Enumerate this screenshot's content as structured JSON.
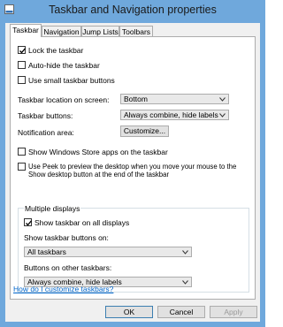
{
  "window": {
    "title": "Taskbar and Navigation properties"
  },
  "tabs": [
    {
      "label": "Taskbar",
      "active": true
    },
    {
      "label": "Navigation"
    },
    {
      "label": "Jump Lists"
    },
    {
      "label": "Toolbars"
    }
  ],
  "taskbar": {
    "lock": {
      "label": "Lock the taskbar",
      "checked": true
    },
    "autohide": {
      "label": "Auto-hide the taskbar",
      "checked": false
    },
    "small_buttons": {
      "label": "Use small taskbar buttons",
      "checked": false
    },
    "location": {
      "label": "Taskbar location on screen:",
      "value": "Bottom"
    },
    "buttons": {
      "label": "Taskbar buttons:",
      "value": "Always combine, hide labels"
    },
    "notification": {
      "label": "Notification area:",
      "button": "Customize..."
    },
    "store_apps": {
      "label": "Show Windows Store apps on the taskbar",
      "checked": false
    },
    "peek": {
      "label_line1": "Use Peek to preview the desktop when you move your mouse to the",
      "label_line2": "Show desktop button at the end of the taskbar",
      "checked": false
    },
    "multiple_displays": {
      "legend": "Multiple displays",
      "show_all": {
        "label": "Show taskbar on all displays",
        "checked": true
      },
      "show_buttons_on": {
        "label": "Show taskbar buttons on:",
        "value": "All taskbars"
      },
      "other_buttons": {
        "label": "Buttons on other taskbars:",
        "value": "Always combine, hide labels"
      }
    },
    "help_link": "How do I customize taskbars?"
  },
  "footer": {
    "ok": "OK",
    "cancel": "Cancel",
    "apply": "Apply"
  },
  "colors": {
    "frame": "#6fa8dc",
    "link": "#0066cc"
  },
  "icons": {
    "app": "taskbar-settings-icon",
    "check": "checkmark-icon",
    "dropdown": "chevron-down-icon"
  }
}
